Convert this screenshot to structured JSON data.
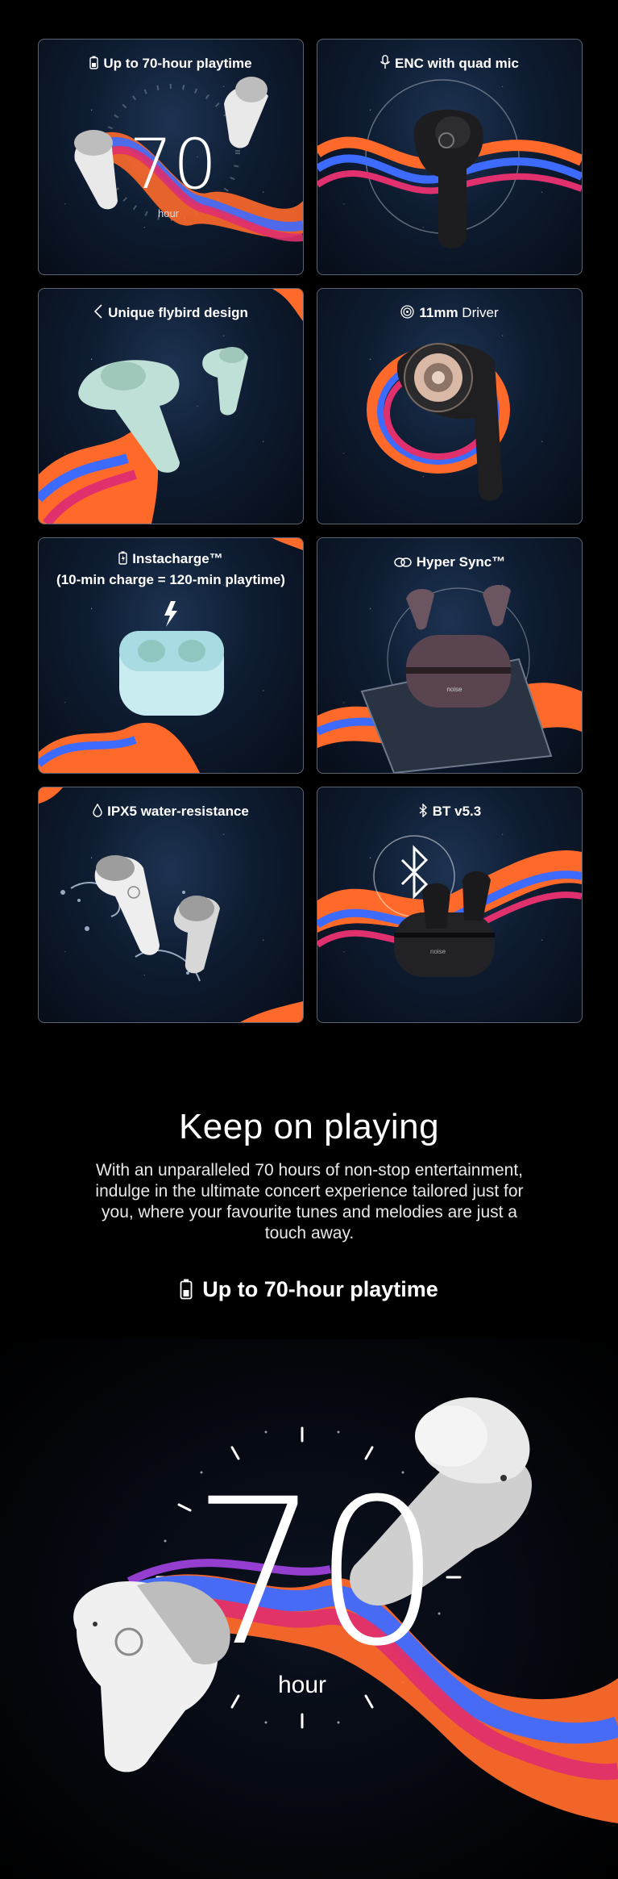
{
  "features": [
    {
      "title_bold": "Up to 70-hour playtime",
      "title_light": "",
      "icon": "battery-icon",
      "number": "70",
      "unit": "hour"
    },
    {
      "title_bold": "ENC with quad mic",
      "title_light": "",
      "icon": "mic-icon"
    },
    {
      "title_bold": "Unique flybird design",
      "title_light": "",
      "icon": "chevron-left-icon"
    },
    {
      "title_bold": "11mm",
      "title_light": " Driver",
      "icon": "driver-icon"
    },
    {
      "title_bold": "Instacharge™",
      "title_line2": "(10-min charge = 120-min playtime)",
      "icon": "battery-icon",
      "case_brand": "noise"
    },
    {
      "title_bold": "Hyper Sync™",
      "title_light": "",
      "icon": "link-icon",
      "case_brand": "noise"
    },
    {
      "title_bold": "IPX5 water-resistance",
      "title_light": "",
      "icon": "drop-icon"
    },
    {
      "title_bold": "BT v5.3",
      "title_light": "",
      "icon": "bluetooth-icon",
      "case_brand": "noise"
    }
  ],
  "section": {
    "heading": "Keep on playing",
    "body": "With an unparalleled 70 hours of non-stop entertainment, indulge in the ultimate concert experience tailored just for you, where your favourite tunes and melodies are just a touch away.",
    "subheading": "Up to 70-hour playtime",
    "subheading_icon": "battery-icon"
  },
  "hero": {
    "number": "70",
    "unit": "hour"
  },
  "colors": {
    "background": "#000000",
    "card_border": "#5a6472",
    "card_bg": "#0e1c31",
    "ribbon_orange": "#ff6a2b",
    "ribbon_pink": "#e0306d",
    "ribbon_blue": "#3d6bff"
  }
}
